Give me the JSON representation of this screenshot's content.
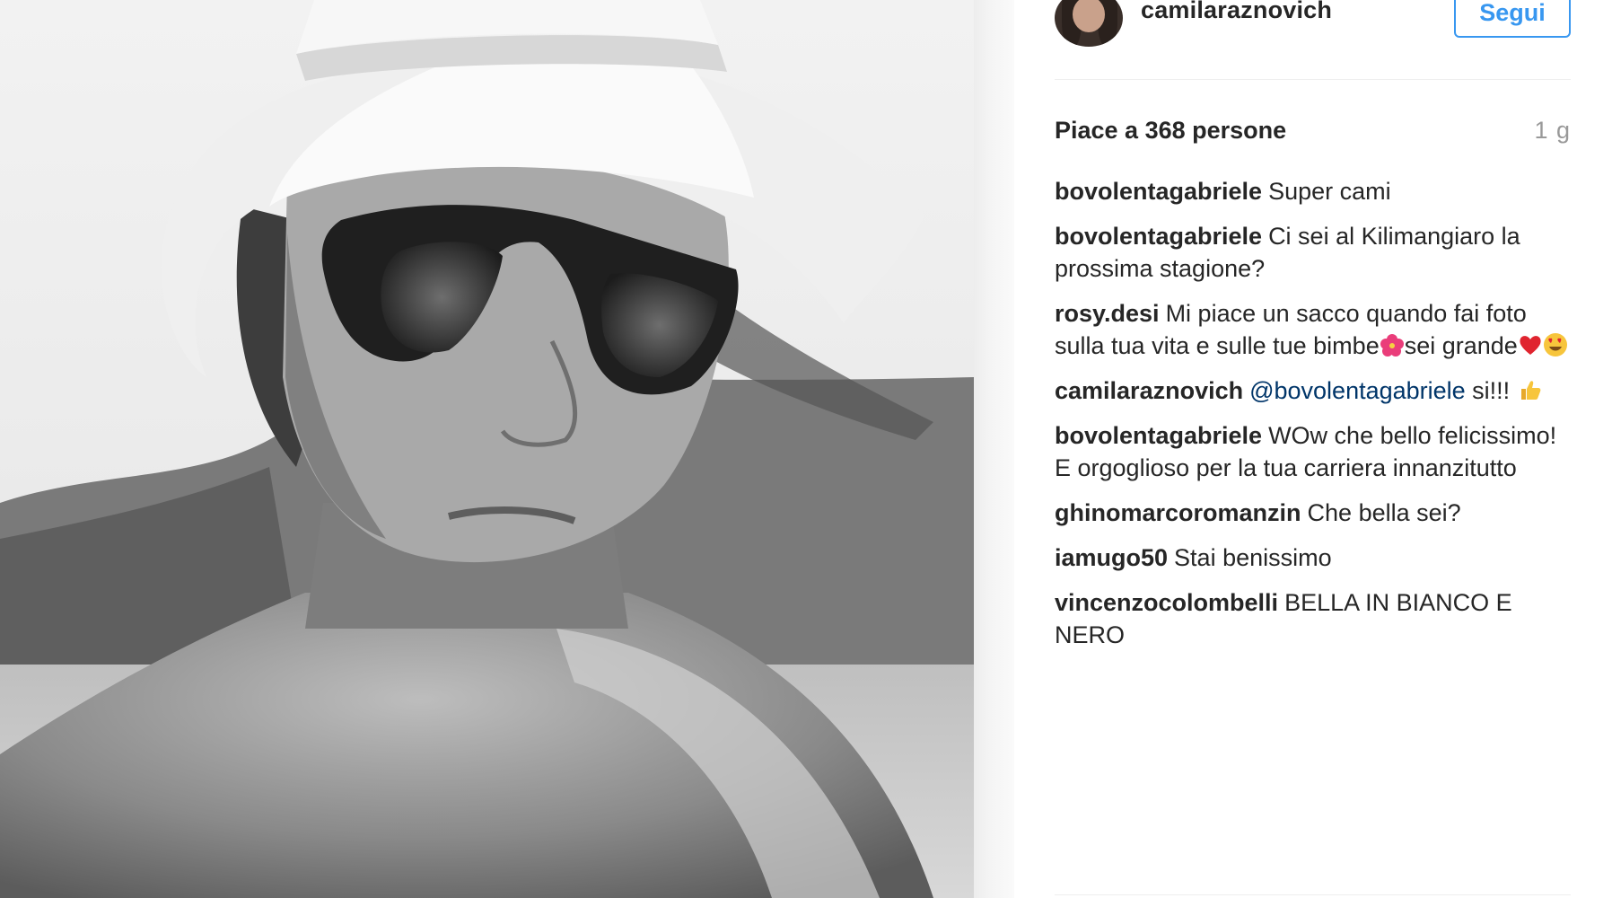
{
  "post": {
    "username": "camilaraznovich",
    "follow_label": "Segui",
    "likes_text": "Piace a 368 persone",
    "time_ago": "1 g"
  },
  "comments": [
    {
      "user": "bovolentagabriele",
      "text": "Super cami"
    },
    {
      "user": "bovolentagabriele",
      "text": "Ci sei al Kilimangiaro la prossima stagione?"
    },
    {
      "user": "rosy.desi",
      "text_before": "Mi piace un sacco quando fai foto sulla tua vita e sulle tue bimbe",
      "text_mid": "sei grande",
      "emoji_1": "hibiscus-emoji",
      "emoji_2": "red-heart-emoji",
      "emoji_3": "heart-eyes-emoji"
    },
    {
      "user": "camilaraznovich",
      "mention": "@bovolentagabriele",
      "text": " si!!! ",
      "emoji": "thumbs-up-emoji"
    },
    {
      "user": "bovolentagabriele",
      "text": "WOw che bello felicissimo! E orgoglioso per la tua carriera innanzitutto"
    },
    {
      "user": "ghinomarcoromanzin",
      "text": "Che bella sei?"
    },
    {
      "user": "iamugo50",
      "text": "Stai benissimo"
    },
    {
      "user": "vincenzocolombelli",
      "text": "BELLA IN BIANCO E NERO"
    }
  ],
  "colors": {
    "accent": "#3897f0",
    "mention": "#003569",
    "text": "#262626",
    "muted": "#999999",
    "divider": "#efefef"
  }
}
